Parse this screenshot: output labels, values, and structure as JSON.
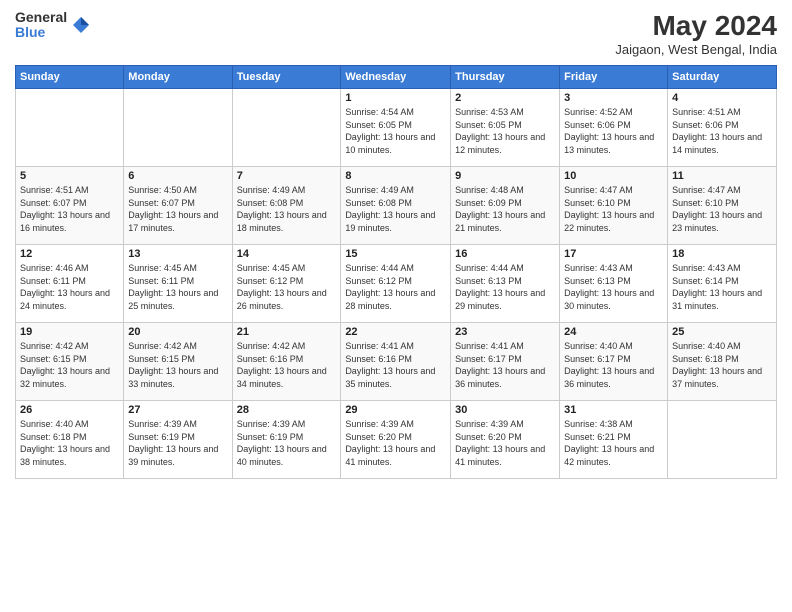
{
  "logo": {
    "general": "General",
    "blue": "Blue"
  },
  "title": "May 2024",
  "location": "Jaigaon, West Bengal, India",
  "days_of_week": [
    "Sunday",
    "Monday",
    "Tuesday",
    "Wednesday",
    "Thursday",
    "Friday",
    "Saturday"
  ],
  "weeks": [
    [
      {
        "day": "",
        "info": ""
      },
      {
        "day": "",
        "info": ""
      },
      {
        "day": "",
        "info": ""
      },
      {
        "day": "1",
        "info": "Sunrise: 4:54 AM\nSunset: 6:05 PM\nDaylight: 13 hours and 10 minutes."
      },
      {
        "day": "2",
        "info": "Sunrise: 4:53 AM\nSunset: 6:05 PM\nDaylight: 13 hours and 12 minutes."
      },
      {
        "day": "3",
        "info": "Sunrise: 4:52 AM\nSunset: 6:06 PM\nDaylight: 13 hours and 13 minutes."
      },
      {
        "day": "4",
        "info": "Sunrise: 4:51 AM\nSunset: 6:06 PM\nDaylight: 13 hours and 14 minutes."
      }
    ],
    [
      {
        "day": "5",
        "info": "Sunrise: 4:51 AM\nSunset: 6:07 PM\nDaylight: 13 hours and 16 minutes."
      },
      {
        "day": "6",
        "info": "Sunrise: 4:50 AM\nSunset: 6:07 PM\nDaylight: 13 hours and 17 minutes."
      },
      {
        "day": "7",
        "info": "Sunrise: 4:49 AM\nSunset: 6:08 PM\nDaylight: 13 hours and 18 minutes."
      },
      {
        "day": "8",
        "info": "Sunrise: 4:49 AM\nSunset: 6:08 PM\nDaylight: 13 hours and 19 minutes."
      },
      {
        "day": "9",
        "info": "Sunrise: 4:48 AM\nSunset: 6:09 PM\nDaylight: 13 hours and 21 minutes."
      },
      {
        "day": "10",
        "info": "Sunrise: 4:47 AM\nSunset: 6:10 PM\nDaylight: 13 hours and 22 minutes."
      },
      {
        "day": "11",
        "info": "Sunrise: 4:47 AM\nSunset: 6:10 PM\nDaylight: 13 hours and 23 minutes."
      }
    ],
    [
      {
        "day": "12",
        "info": "Sunrise: 4:46 AM\nSunset: 6:11 PM\nDaylight: 13 hours and 24 minutes."
      },
      {
        "day": "13",
        "info": "Sunrise: 4:45 AM\nSunset: 6:11 PM\nDaylight: 13 hours and 25 minutes."
      },
      {
        "day": "14",
        "info": "Sunrise: 4:45 AM\nSunset: 6:12 PM\nDaylight: 13 hours and 26 minutes."
      },
      {
        "day": "15",
        "info": "Sunrise: 4:44 AM\nSunset: 6:12 PM\nDaylight: 13 hours and 28 minutes."
      },
      {
        "day": "16",
        "info": "Sunrise: 4:44 AM\nSunset: 6:13 PM\nDaylight: 13 hours and 29 minutes."
      },
      {
        "day": "17",
        "info": "Sunrise: 4:43 AM\nSunset: 6:13 PM\nDaylight: 13 hours and 30 minutes."
      },
      {
        "day": "18",
        "info": "Sunrise: 4:43 AM\nSunset: 6:14 PM\nDaylight: 13 hours and 31 minutes."
      }
    ],
    [
      {
        "day": "19",
        "info": "Sunrise: 4:42 AM\nSunset: 6:15 PM\nDaylight: 13 hours and 32 minutes."
      },
      {
        "day": "20",
        "info": "Sunrise: 4:42 AM\nSunset: 6:15 PM\nDaylight: 13 hours and 33 minutes."
      },
      {
        "day": "21",
        "info": "Sunrise: 4:42 AM\nSunset: 6:16 PM\nDaylight: 13 hours and 34 minutes."
      },
      {
        "day": "22",
        "info": "Sunrise: 4:41 AM\nSunset: 6:16 PM\nDaylight: 13 hours and 35 minutes."
      },
      {
        "day": "23",
        "info": "Sunrise: 4:41 AM\nSunset: 6:17 PM\nDaylight: 13 hours and 36 minutes."
      },
      {
        "day": "24",
        "info": "Sunrise: 4:40 AM\nSunset: 6:17 PM\nDaylight: 13 hours and 36 minutes."
      },
      {
        "day": "25",
        "info": "Sunrise: 4:40 AM\nSunset: 6:18 PM\nDaylight: 13 hours and 37 minutes."
      }
    ],
    [
      {
        "day": "26",
        "info": "Sunrise: 4:40 AM\nSunset: 6:18 PM\nDaylight: 13 hours and 38 minutes."
      },
      {
        "day": "27",
        "info": "Sunrise: 4:39 AM\nSunset: 6:19 PM\nDaylight: 13 hours and 39 minutes."
      },
      {
        "day": "28",
        "info": "Sunrise: 4:39 AM\nSunset: 6:19 PM\nDaylight: 13 hours and 40 minutes."
      },
      {
        "day": "29",
        "info": "Sunrise: 4:39 AM\nSunset: 6:20 PM\nDaylight: 13 hours and 41 minutes."
      },
      {
        "day": "30",
        "info": "Sunrise: 4:39 AM\nSunset: 6:20 PM\nDaylight: 13 hours and 41 minutes."
      },
      {
        "day": "31",
        "info": "Sunrise: 4:38 AM\nSunset: 6:21 PM\nDaylight: 13 hours and 42 minutes."
      },
      {
        "day": "",
        "info": ""
      }
    ]
  ]
}
